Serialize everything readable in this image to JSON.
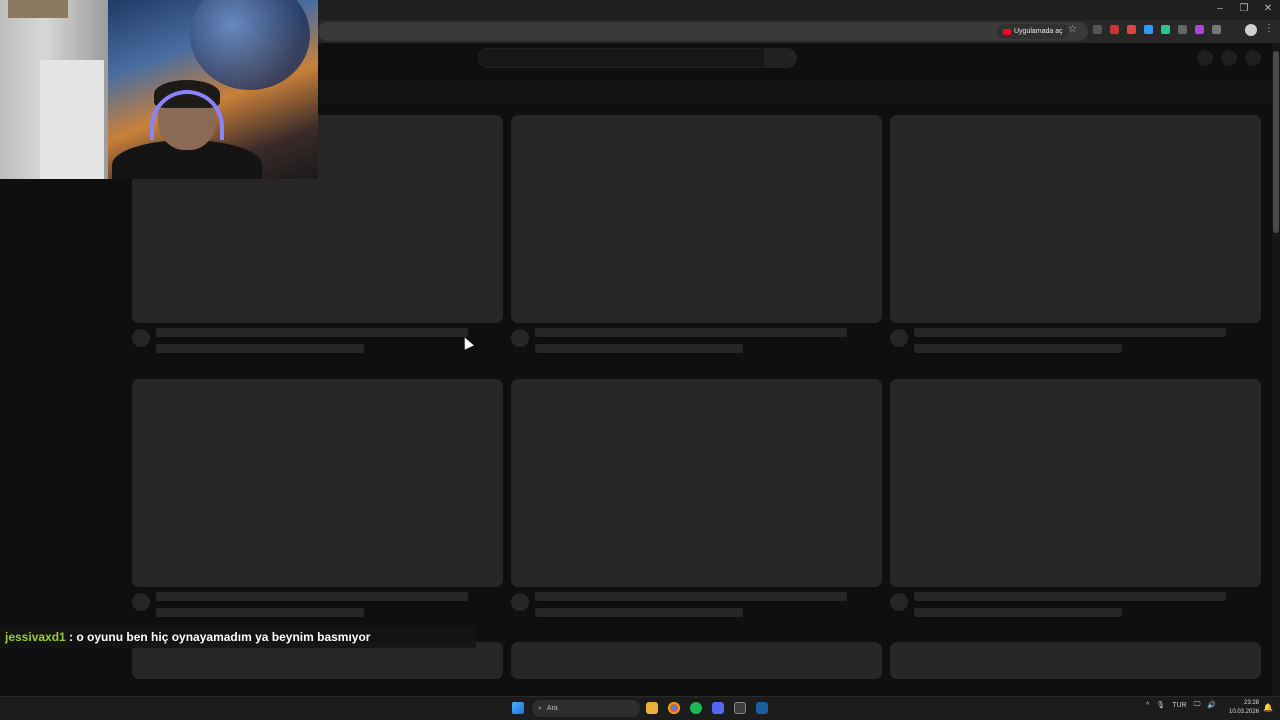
{
  "browser": {
    "open_in_app_label": "Uygulamada aç",
    "window_controls": [
      "–",
      "❐",
      "✕"
    ],
    "star_icon": "☆",
    "menu_icon": "⋮"
  },
  "chat": {
    "username": "jessivaxd1",
    "message": " : o oyunu ben hiç oynayamadım ya beynim basmıyor"
  },
  "taskbar": {
    "search_icon": "⌕",
    "search_placeholder": "Ara",
    "tray_chevron": "^",
    "mic_icon": "🎙",
    "language": "TUR",
    "network_icon": "🖵",
    "volume_icon": "🔊",
    "time": "23:28",
    "date": "10.03.2026",
    "notification_icon": "🔔"
  },
  "colors": {
    "accent_red": "#ff0033",
    "chat_user": "#9acd32",
    "skeleton": "#272727"
  }
}
